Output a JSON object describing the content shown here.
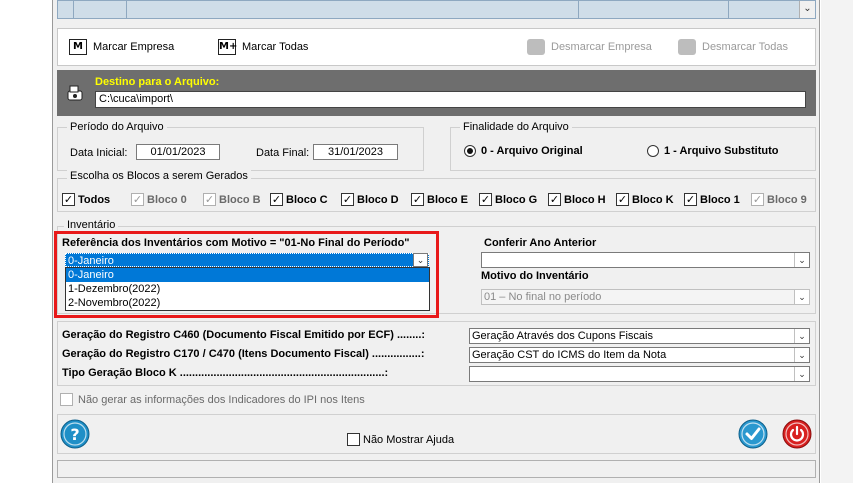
{
  "toolbar": {
    "marcar_empresa": "Marcar Empresa",
    "marcar_todas": "Marcar Todas",
    "desmarcar_empresa": "Desmarcar Empresa",
    "desmarcar_todas": "Desmarcar Todas"
  },
  "destino": {
    "title": "Destino para o Arquivo:",
    "path": "C:\\cuca\\import\\"
  },
  "periodo": {
    "title": "Período do Arquivo",
    "data_inicial_label": "Data Inicial:",
    "data_inicial": "01/01/2023",
    "data_final_label": "Data Final:",
    "data_final": "31/01/2023"
  },
  "finalidade": {
    "title": "Finalidade do Arquivo",
    "options": [
      "0 - Arquivo Original",
      "1 - Arquivo Substituto"
    ],
    "selected": "0 - Arquivo Original"
  },
  "blocos": {
    "title": "Escolha os Blocos a serem Gerados",
    "items": [
      {
        "label": "Todos",
        "checked": true,
        "enabled": true
      },
      {
        "label": "Bloco 0",
        "checked": true,
        "enabled": false
      },
      {
        "label": "Bloco B",
        "checked": true,
        "enabled": false
      },
      {
        "label": "Bloco C",
        "checked": true,
        "enabled": true
      },
      {
        "label": "Bloco D",
        "checked": true,
        "enabled": true
      },
      {
        "label": "Bloco E",
        "checked": true,
        "enabled": true
      },
      {
        "label": "Bloco G",
        "checked": true,
        "enabled": true
      },
      {
        "label": "Bloco H",
        "checked": true,
        "enabled": true
      },
      {
        "label": "Bloco K",
        "checked": true,
        "enabled": true
      },
      {
        "label": "Bloco 1",
        "checked": true,
        "enabled": true
      },
      {
        "label": "Bloco 9",
        "checked": true,
        "enabled": false
      }
    ]
  },
  "inventario": {
    "title": "Inventário",
    "ref_label": "Referência dos Inventários com Motivo = \"01-No Final do Período\"",
    "selected": "0-Janeiro",
    "options": [
      "0-Janeiro",
      "1-Dezembro(2022)",
      "2-Novembro(2022)"
    ],
    "conferir_label": "Conferir Ano Anterior",
    "conferir_value": "",
    "motivo_label": "Motivo do Inventário",
    "motivo_value": "01 – No final no período"
  },
  "registros": {
    "c460_label": "Geração do Registro C460 (Documento Fiscal Emitido por ECF) ........:",
    "c460_value": "Geração Através dos Cupons Fiscais",
    "c170_label": "Geração do Registro C170 / C470 (Itens Documento Fiscal) ................:",
    "c170_value": "Geração CST do ICMS do Item da Nota",
    "bloco_k_label": "Tipo Geração Bloco K ...................................................................:",
    "bloco_k_value": ""
  },
  "ipi_checkbox": "Não gerar as informações dos Indicadores do IPI nos Itens",
  "nao_mostrar_ajuda": "Não Mostrar Ajuda",
  "colors": {
    "highlight": "#0078d7",
    "red_frame": "#e8191a",
    "help_button": "#1f8fc7",
    "ok_button": "#2a98cf",
    "power_button": "#d8201f",
    "dest_bar": "#6e6e6e",
    "dest_title": "#ffff00"
  }
}
